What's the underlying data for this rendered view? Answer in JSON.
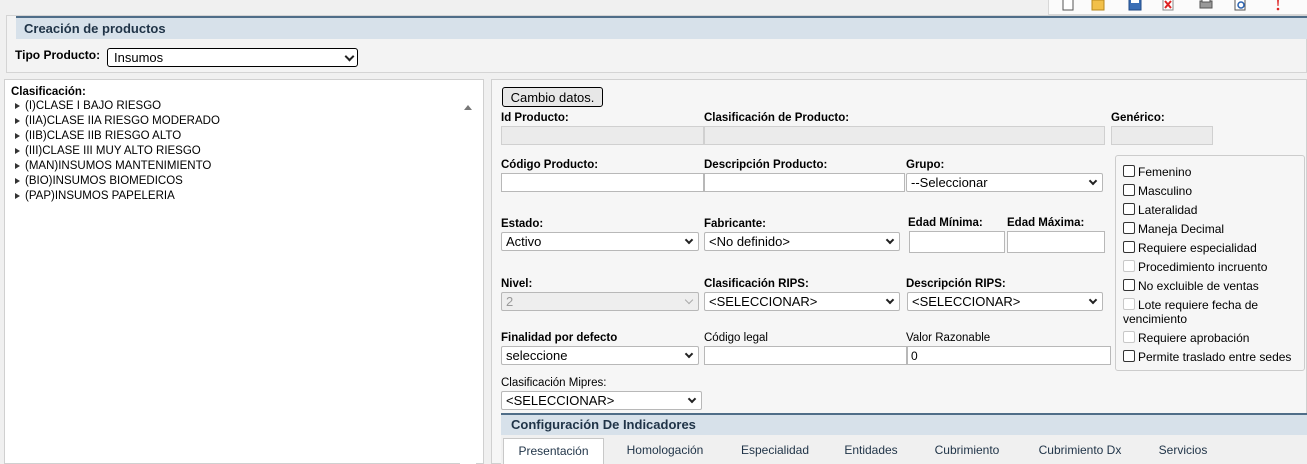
{
  "toolbar": {
    "icons": [
      "new-doc-icon",
      "open-folder-icon",
      "save-icon",
      "delete-icon",
      "print-icon",
      "preview-icon",
      "help-icon"
    ]
  },
  "header": {
    "title": "Creación de productos",
    "tipo_label": "Tipo Producto:",
    "tipo_value": "Insumos"
  },
  "tree": {
    "label": "Clasificación:",
    "items": [
      "(I)CLASE I BAJO RIESGO",
      "(IIA)CLASE IIA RIESGO MODERADO",
      "(IIB)CLASE IIB RIESGO ALTO",
      "(III)CLASE III MUY ALTO RIESGO",
      "(MAN)INSUMOS MANTENIMIENTO",
      "(BIO)INSUMOS BIOMEDICOS",
      "(PAP)INSUMOS PAPELERIA"
    ]
  },
  "form": {
    "cambio_button": "Cambio datos.",
    "id_producto_label": "Id Producto:",
    "clasificacion_producto_label": "Clasificación de Producto:",
    "generico_label": "Genérico:",
    "codigo_producto_label": "Código Producto:",
    "descripcion_producto_label": "Descripción Producto:",
    "grupo_label": "Grupo:",
    "grupo_value": "--Seleccionar",
    "estado_label": "Estado:",
    "estado_value": "Activo",
    "fabricante_label": "Fabricante:",
    "fabricante_value": "<No definido>",
    "edad_minima_label": "Edad Mínima:",
    "edad_maxima_label": "Edad Máxima:",
    "nivel_label": "Nivel:",
    "nivel_value": "2",
    "clasificacion_rips_label": "Clasificación RIPS:",
    "clasificacion_rips_value": "<SELECCIONAR>",
    "descripcion_rips_label": "Descripción RIPS:",
    "descripcion_rips_value": "<SELECCIONAR>",
    "finalidad_label": "Finalidad por defecto",
    "finalidad_value": "seleccione",
    "codigo_legal_label": "Código legal",
    "valor_razonable_label": "Valor Razonable",
    "valor_razonable_value": "0",
    "clasificacion_mipres_label": "Clasificación Mipres:",
    "clasificacion_mipres_value": "<SELECCIONAR>"
  },
  "checkboxes": [
    {
      "label": "Femenino",
      "enabled": true
    },
    {
      "label": "Masculino",
      "enabled": true
    },
    {
      "label": "Lateralidad",
      "enabled": true
    },
    {
      "label": "Maneja Decimal",
      "enabled": true
    },
    {
      "label": "Requiere especialidad",
      "enabled": true
    },
    {
      "label": "Procedimiento incruento",
      "enabled": false
    },
    {
      "label": "No excluible de ventas",
      "enabled": true
    },
    {
      "label": "Lote requiere fecha de vencimiento",
      "enabled": false
    },
    {
      "label": "Requiere aprobación",
      "enabled": false
    },
    {
      "label": "Permite traslado entre sedes",
      "enabled": true
    }
  ],
  "indicators": {
    "title": "Configuración De Indicadores",
    "tabs": [
      "Presentación",
      "Homologación",
      "Especialidad",
      "Entidades",
      "Cubrimiento",
      "Cubrimiento Dx",
      "Servicios"
    ],
    "active_tab": "Presentación"
  },
  "colors": {
    "header_bg": "#d7e1ea",
    "header_border": "#4f6d88",
    "header_text": "#1f3347"
  }
}
